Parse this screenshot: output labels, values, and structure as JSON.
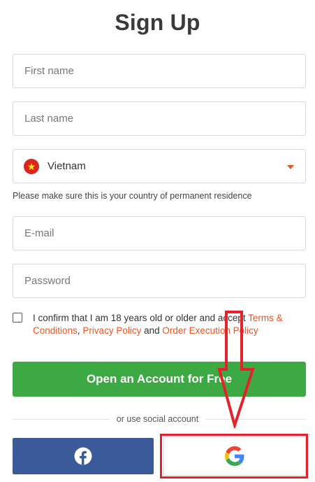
{
  "form": {
    "title": "Sign Up",
    "first_name_placeholder": "First name",
    "last_name_placeholder": "Last name",
    "country": {
      "flag": "vietnam-flag",
      "star": "★",
      "selected": "Vietnam"
    },
    "country_hint": "Please make sure this is your country of permanent residence",
    "email_placeholder": "E-mail",
    "password_placeholder": "Password",
    "consent": {
      "text_1": "I confirm that I am 18 years old or older and accept ",
      "terms_link": "Terms & Conditions",
      "sep_1": ", ",
      "privacy_link": "Privacy Policy",
      "sep_2": " and ",
      "order_link": "Order Execution Policy"
    },
    "submit_label": "Open an Account for Free",
    "social_divider": "or use social account"
  },
  "social": {
    "facebook_icon": "facebook-icon",
    "google_icon": "google-icon"
  },
  "colors": {
    "accent": "#ef5323",
    "primary_button": "#3ca942",
    "facebook": "#3b5a9a",
    "annotation": "#e3232b"
  },
  "annotation": {
    "arrow_icon": "down-arrow-annotation",
    "box": "highlight-box-annotation"
  }
}
